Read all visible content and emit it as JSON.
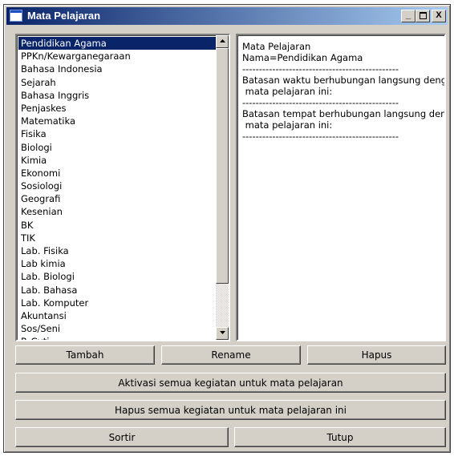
{
  "window": {
    "title": "Mata Pelajaran",
    "minimize_label": "_",
    "maximize_icon": "maximize-icon",
    "close_label": "X"
  },
  "subjects": {
    "selected_index": 0,
    "items": [
      "Pendidikan Agama",
      "PPKn/Kewarganegaraan",
      "Bahasa Indonesia",
      "Sejarah",
      "Bahasa Inggris",
      "Penjaskes",
      "Matematika",
      "Fisika",
      "Biologi",
      "Kimia",
      "Ekonomi",
      "Sosiologi",
      "Geografi",
      "Kesenian",
      "BK",
      "TIK",
      "Lab. Fisika",
      "Lab kimia",
      "Lab. Biologi",
      "Lab. Bahasa",
      "Lab. Komputer",
      "Akuntansi",
      "Sos/Seni",
      "P. Cuti"
    ]
  },
  "info": {
    "lines": [
      "Mata Pelajaran",
      "Nama=Pendidikan Agama",
      "-----------------------------------------------",
      "Batasan waktu berhubungan langsung dengan",
      " mata pelajaran ini:",
      "-----------------------------------------------",
      "Batasan tempat berhubungan langsung dengan",
      " mata pelajaran ini:",
      "-----------------------------------------------"
    ]
  },
  "buttons": {
    "add": "Tambah",
    "rename": "Rename",
    "delete": "Hapus",
    "activate_all": "Aktivasi semua kegiatan untuk mata pelajaran",
    "delete_all": "Hapus semua kegiatan untuk mata pelajaran ini",
    "sort": "Sortir",
    "close": "Tutup"
  },
  "colors": {
    "window_bg": "#d4d0c8",
    "title_gradient_start": "#0a246a",
    "title_gradient_end": "#a6caf0",
    "selection_bg": "#0a246a"
  }
}
